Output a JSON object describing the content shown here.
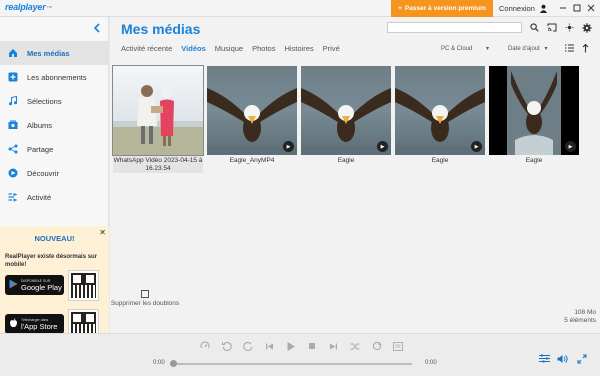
{
  "app": {
    "logo": "realplayer",
    "logo_suffix": "™",
    "premium_label": "Passer à version premium",
    "connexion_label": "Connexion"
  },
  "sidebar": {
    "items": [
      {
        "label": "Mes médias",
        "icon": "home-icon",
        "active": true
      },
      {
        "label": "Les abonnements",
        "icon": "plus-square-icon"
      },
      {
        "label": "Sélections",
        "icon": "music-note-icon"
      },
      {
        "label": "Albums",
        "icon": "album-icon"
      },
      {
        "label": "Partage",
        "icon": "share-icon"
      },
      {
        "label": "Découvrir",
        "icon": "compass-icon"
      },
      {
        "label": "Activité",
        "icon": "activity-icon"
      }
    ],
    "promo": {
      "title": "NOUVEAU!",
      "text": "RealPlayer existe désormais sur mobile!",
      "google_small": "DISPONIBLE SUR",
      "google_large": "Google Play",
      "apple_small": "Télécharger dans",
      "apple_large": "l'App Store"
    }
  },
  "main": {
    "title": "Mes médias",
    "tabs": [
      {
        "label": "Activité récente"
      },
      {
        "label": "Vidéos",
        "active": true
      },
      {
        "label": "Musique"
      },
      {
        "label": "Photos"
      },
      {
        "label": "Histoires"
      },
      {
        "label": "Privé"
      }
    ],
    "source_filter": "PC & Cloud",
    "sort_filter": "Date d'ajout",
    "media": [
      {
        "title": "WhatsApp Vidéo 2023-04-15 à 16.23.54",
        "kind": "family"
      },
      {
        "title": "Eagle_AnyMP4",
        "kind": "eagle"
      },
      {
        "title": "Eagle",
        "kind": "eagle"
      },
      {
        "title": "Eagle",
        "kind": "eagle"
      },
      {
        "title": "Eagle",
        "kind": "eagle-dark"
      }
    ],
    "remove_duplicates": "Supprimer les doublons",
    "size": "108 Mo",
    "count": "5 éléments"
  },
  "player": {
    "time_start": "0:00",
    "time_end": "0:00",
    "progress": 0
  },
  "colors": {
    "accent": "#1a82d8",
    "premium": "#f7941d"
  }
}
